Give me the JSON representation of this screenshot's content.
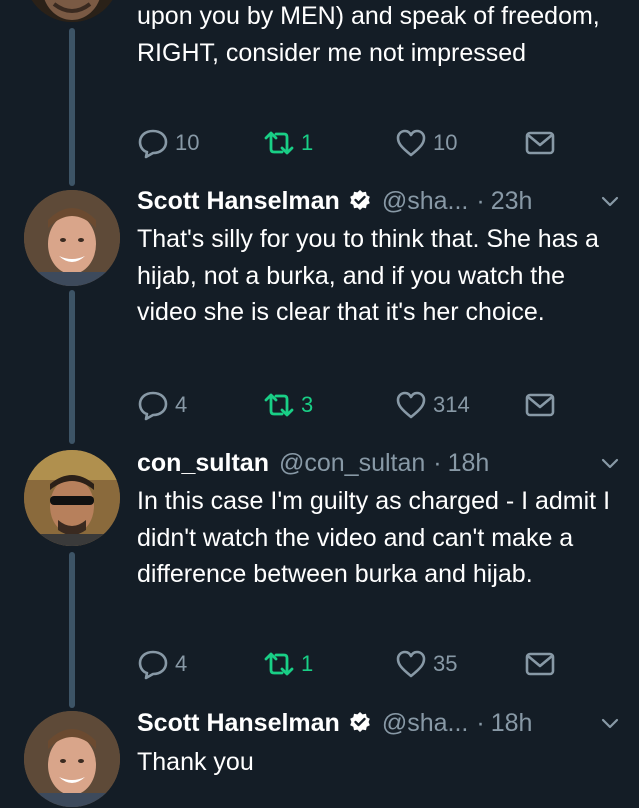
{
  "colors": {
    "background": "#141d26",
    "muted": "#8899a6",
    "retweet": "#19cf86",
    "verified": "#ffffff"
  },
  "tweets": [
    {
      "text": "upon you by MEN) and speak of freedom, RIGHT, consider me not impressed",
      "replies": "10",
      "retweets": "1",
      "likes": "10"
    },
    {
      "name": "Scott Hanselman",
      "handle": "@sha...",
      "time": "23h",
      "text": "That's silly for you to think that. She has a hijab, not a burka, and if you watch the video she is clear that it's her choice.",
      "replies": "4",
      "retweets": "3",
      "likes": "314"
    },
    {
      "name": "con_sultan",
      "handle": "@con_sultan",
      "time": "18h",
      "text": "In this case I'm guilty as charged - I admit I didn't watch the video and can't make a difference between burka and hijab.",
      "replies": "4",
      "retweets": "1",
      "likes": "35"
    },
    {
      "name": "Scott Hanselman",
      "handle": "@sha...",
      "time": "18h",
      "text": "Thank you"
    }
  ],
  "separator": "·",
  "icons": {
    "reply": "reply-icon",
    "retweet": "retweet-icon",
    "like": "heart-icon",
    "message": "envelope-icon",
    "verified": "verified-badge-icon",
    "menu": "chevron-down-icon"
  }
}
